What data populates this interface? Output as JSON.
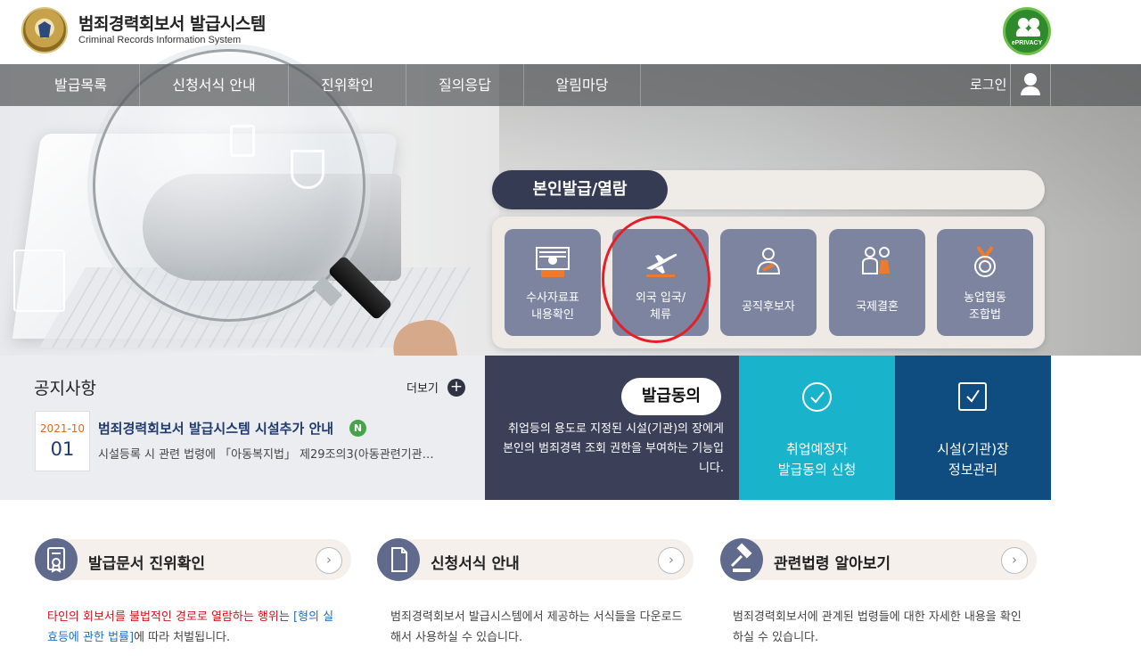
{
  "header": {
    "title": "범죄경력회보서 발급시스템",
    "subtitle": "Criminal Records Information System",
    "privacy_badge": "ePRIVACY"
  },
  "nav": {
    "items": [
      {
        "label": "발급목록"
      },
      {
        "label": "신청서식 안내"
      },
      {
        "label": "진위확인"
      },
      {
        "label": "질의응답"
      },
      {
        "label": "알림마당"
      }
    ],
    "login": "로그인"
  },
  "issue_panel": {
    "tab": "본인발급/열람",
    "services": [
      {
        "label": "수사자료표\n내용확인",
        "icon": "record-card-icon"
      },
      {
        "label": "외국 입국/\n체류",
        "icon": "airplane-icon"
      },
      {
        "label": "공직후보자",
        "icon": "candidate-icon"
      },
      {
        "label": "국제결혼",
        "icon": "couple-icon"
      },
      {
        "label": "농업협동\n조합법",
        "icon": "medal-icon"
      }
    ]
  },
  "notice": {
    "title": "공지사항",
    "more": "더보기",
    "item": {
      "year_month": "2021-10",
      "day": "01",
      "headline": "범죄경력회보서 발급시스템 시설추가 안내",
      "badge": "N",
      "body": "시설등록 시 관련 법령에 「아동복지법」 제29조의3(아동관련기관…"
    }
  },
  "consent": {
    "pill": "발급동의",
    "description": "취업등의 용도로 지정된 시설(기관)의 장에게 본인의 범죄경력 조회 권한을 부여하는 기능입니다.",
    "apply": "취업예정자\n발급동의 신청",
    "manage": "시설(기관)장\n정보관리"
  },
  "cards": [
    {
      "title": "발급문서 진위확인",
      "icon": "certificate-icon",
      "desc_red": "타인의 회보서를 불법적인 경로로 열람하는 행위",
      "desc_mid": "는 ",
      "desc_blue": "[형의 실효등에 관한 법률]",
      "desc_end": "에 따라 처벌됩니다."
    },
    {
      "title": "신청서식 안내",
      "icon": "document-icon",
      "desc": "범죄경력회보서 발급시스템에서 제공하는 서식들을 다운로드해서 사용하실 수 있습니다."
    },
    {
      "title": "관련법령 알아보기",
      "icon": "gavel-icon",
      "desc": "범죄경력회보서에 관계된 법령들에 대한 자세한 내용을 확인하실 수 있습니다."
    }
  ],
  "colors": {
    "nav_bg": "#585a5c",
    "panel_pill": "#363b54",
    "service_tile": "#7d84a0",
    "consent_bg": "#3b4058",
    "cyan_tile": "#19b3cc",
    "navy_tile": "#0f4c80",
    "annotation_circle": "#e2202a"
  }
}
